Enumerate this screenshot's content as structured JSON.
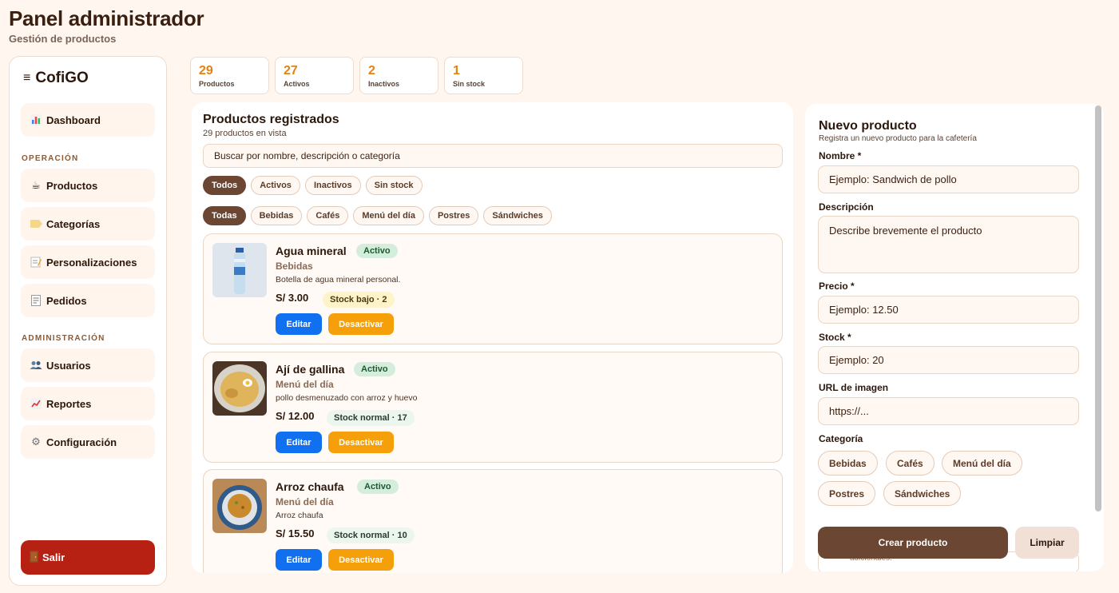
{
  "header": {
    "title": "Panel administrador",
    "subtitle": "Gestión de productos"
  },
  "sidebar": {
    "brand": "CofiGO",
    "brand_icon": "hamburger-icon",
    "dashboard": {
      "label": "Dashboard",
      "icon": "chart-icon"
    },
    "section_operacion": "OPERACIÓN",
    "items_operacion": [
      {
        "label": "Productos",
        "icon": "coffee-icon"
      },
      {
        "label": "Categorías",
        "icon": "tag-icon"
      },
      {
        "label": "Personalizaciones",
        "icon": "memo-icon"
      },
      {
        "label": "Pedidos",
        "icon": "receipt-icon"
      }
    ],
    "section_admin": "ADMINISTRACIÓN",
    "items_admin": [
      {
        "label": "Usuarios",
        "icon": "users-icon"
      },
      {
        "label": "Reportes",
        "icon": "trend-icon"
      },
      {
        "label": "Configuración",
        "icon": "gear-icon"
      }
    ],
    "logout": {
      "label": "Salir",
      "icon": "door-icon",
      "color": "#b72114"
    }
  },
  "stats": [
    {
      "value": "29",
      "label": "Productos"
    },
    {
      "value": "27",
      "label": "Activos"
    },
    {
      "value": "2",
      "label": "Inactivos"
    },
    {
      "value": "1",
      "label": "Sin stock"
    }
  ],
  "products": {
    "title": "Productos registrados",
    "count": "29 productos en vista",
    "search_placeholder": "Buscar por nombre, descripción o categoría",
    "status_filters": [
      "Todos",
      "Activos",
      "Inactivos",
      "Sin stock"
    ],
    "category_filters": [
      "Todas",
      "Bebidas",
      "Cafés",
      "Menú del día",
      "Postres",
      "Sándwiches"
    ],
    "items": [
      {
        "name": "Agua mineral",
        "status": "Activo",
        "category": "Bebidas",
        "description": "Botella de agua mineral personal.",
        "price": "S/ 3.00",
        "stock": "Stock bajo · 2",
        "edit": "Editar",
        "deactivate": "Desactivar"
      },
      {
        "name": "Ají de gallina",
        "status": "Activo",
        "category": "Menú del día",
        "description": "pollo desmenuzado con arroz y huevo",
        "price": "S/ 12.00",
        "stock": "Stock normal · 17",
        "edit": "Editar",
        "deactivate": "Desactivar"
      },
      {
        "name": "Arroz chaufa",
        "status": "Activo",
        "category": "Menú del día",
        "description": "Arroz chaufa",
        "price": "S/ 15.50",
        "stock": "Stock normal · 10",
        "edit": "Editar",
        "deactivate": "Desactivar"
      }
    ]
  },
  "form": {
    "title": "Nuevo producto",
    "hint": "Registra un nuevo producto para la cafetería",
    "name_label": "Nombre *",
    "name_placeholder": "Ejemplo: Sandwich de pollo",
    "desc_label": "Descripción",
    "desc_placeholder": "Describe brevemente el producto",
    "price_label": "Precio *",
    "price_placeholder": "Ejemplo: 12.50",
    "stock_label": "Stock *",
    "stock_placeholder": "Ejemplo: 20",
    "image_label": "URL de imagen",
    "image_placeholder": "https://...",
    "category_label": "Categoría",
    "categories": [
      "Bebidas",
      "Cafés",
      "Menú del día",
      "Postres",
      "Sándwiches"
    ],
    "create_label": "Crear producto",
    "clear_label": "Limpiar",
    "peek_text": "adicionales."
  },
  "colors": {
    "accent": "#e08316",
    "brown": "#6b4632",
    "edit": "#1170f0",
    "deactivate": "#f59f0b"
  }
}
